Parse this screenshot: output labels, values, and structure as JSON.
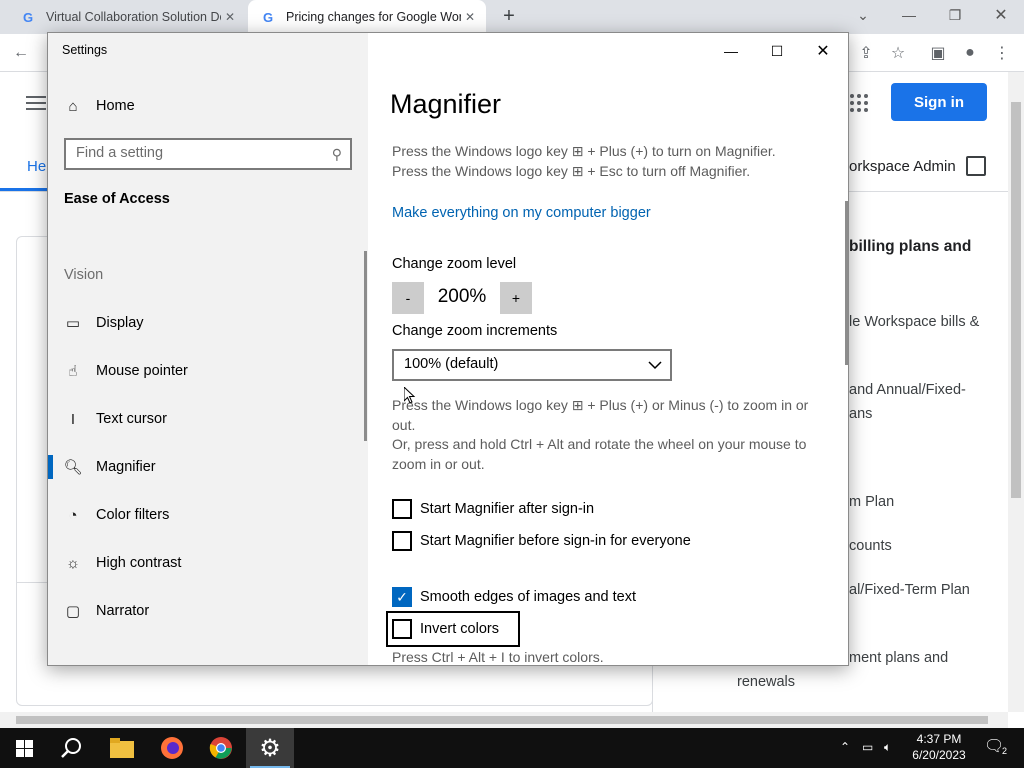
{
  "browser": {
    "tabs": [
      {
        "title": "Virtual Collaboration Solution De",
        "active": false
      },
      {
        "title": "Pricing changes for Google Work",
        "active": true
      }
    ]
  },
  "webpage": {
    "sign_in": "Sign in",
    "help_tab": "Hel",
    "workspace_admin": "orkspace Admin",
    "right_items": [
      "billing plans and",
      "le Workspace bills &",
      "and Annual/Fixed-",
      "ans",
      "m Plan",
      "counts",
      "al/Fixed-Term Plan",
      "ment plans and",
      "renewals"
    ]
  },
  "settings": {
    "window_title": "Settings",
    "home": "Home",
    "search_placeholder": "Find a setting",
    "section": "Ease of Access",
    "group": "Vision",
    "nav": [
      {
        "label": "Display",
        "icon": "monitor-icon"
      },
      {
        "label": "Mouse pointer",
        "icon": "pointer-icon"
      },
      {
        "label": "Text cursor",
        "icon": "text-cursor-icon"
      },
      {
        "label": "Magnifier",
        "icon": "magnifier-icon",
        "selected": true
      },
      {
        "label": "Color filters",
        "icon": "palette-icon"
      },
      {
        "label": "High contrast",
        "icon": "sun-icon"
      },
      {
        "label": "Narrator",
        "icon": "narrator-icon"
      }
    ],
    "page_title": "Magnifier",
    "shortcut_on": "Press the Windows logo key ⊞ + Plus (+) to turn on Magnifier.",
    "shortcut_off": "Press the Windows logo key ⊞ + Esc to turn off Magnifier.",
    "link": "Make everything on my computer bigger",
    "zoom_level_label": "Change zoom level",
    "zoom_minus": "-",
    "zoom_value": "200%",
    "zoom_plus": "+",
    "zoom_increment_label": "Change zoom increments",
    "zoom_increment_value": "100% (default)",
    "zoom_hint_1": "Press the Windows logo key ⊞ + Plus (+) or Minus (-) to zoom in or out.",
    "zoom_hint_2": "Or, press and hold Ctrl + Alt and rotate the wheel on your mouse to zoom in or out.",
    "checkboxes": [
      {
        "label": "Start Magnifier after sign-in",
        "checked": false
      },
      {
        "label": "Start Magnifier before sign-in for everyone",
        "checked": false
      },
      {
        "label": "Smooth edges of images and text",
        "checked": true
      },
      {
        "label": "Invert colors",
        "checked": false
      }
    ],
    "invert_hint": "Press Ctrl + Alt + I to invert colors."
  },
  "taskbar": {
    "time": "4:37 PM",
    "date": "6/20/2023",
    "notification_count": "2"
  },
  "colors": {
    "accent": "#0067c0",
    "link": "#0063b1",
    "chrome_blue": "#1a73e8"
  }
}
